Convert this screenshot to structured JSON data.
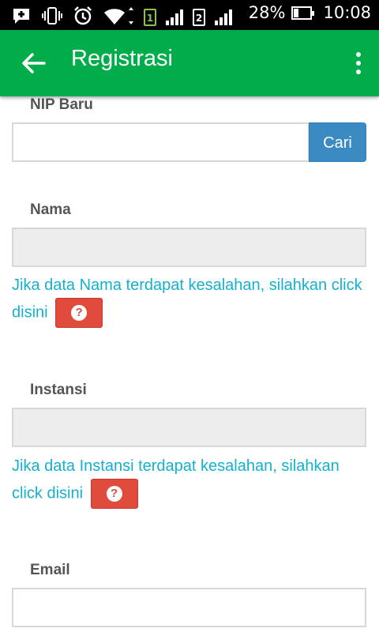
{
  "status_bar": {
    "sim1": "1",
    "sim2": "2",
    "battery_percent": "28%",
    "time": "10:08"
  },
  "app_bar": {
    "title": "Registrasi",
    "color": "#00ad4a"
  },
  "form": {
    "nip": {
      "label": "NIP Baru",
      "value": "",
      "search_label": "Cari"
    },
    "nama": {
      "label": "Nama",
      "value": "",
      "help_text": "Jika data Nama terdapat kesalahan, silahkan click disini"
    },
    "instansi": {
      "label": "Instansi",
      "value": "",
      "help_text": "Jika data Instansi terdapat kesalahan, silahkan click disini"
    },
    "email": {
      "label": "Email",
      "value": ""
    }
  },
  "colors": {
    "help_link": "#14b0cf",
    "help_button": "#e14b3b",
    "search_button": "#3b8bc2"
  }
}
